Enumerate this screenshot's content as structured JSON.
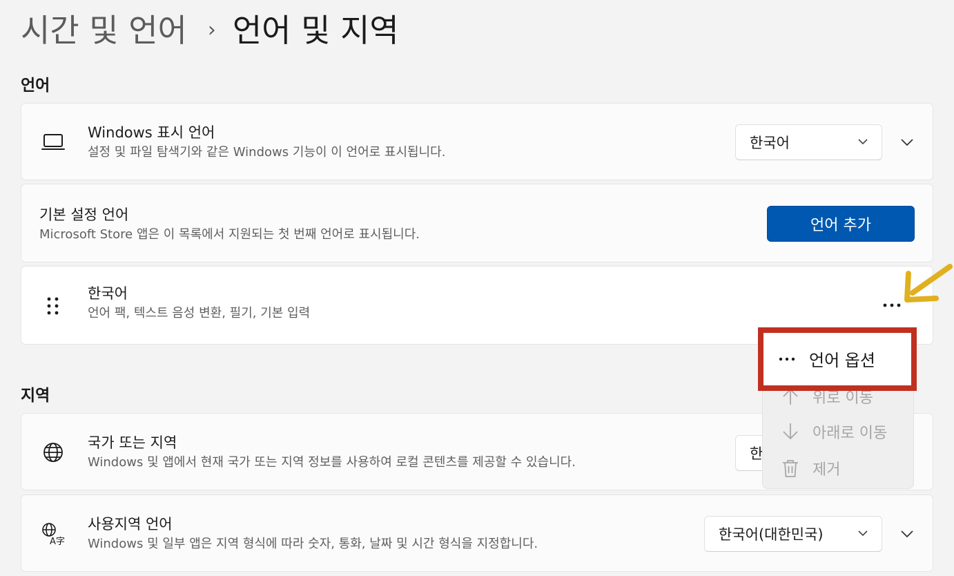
{
  "breadcrumb": {
    "parent": "시간 및 언어",
    "separator": "›",
    "current": "언어 및 지역"
  },
  "language_section": {
    "heading": "언어",
    "display_language": {
      "title": "Windows 표시 언어",
      "description": "설정 및 파일 탐색기와 같은 Windows 기능이 이 언어로 표시됩니다.",
      "selected": "한국어",
      "icon": "laptop-icon"
    },
    "preferred_languages": {
      "title": "기본 설정 언어",
      "description": "Microsoft Store 앱은 이 목록에서 지원되는 첫 번째 언어로 표시됩니다.",
      "add_button": "언어 추가"
    },
    "korean_entry": {
      "title": "한국어",
      "description": "언어 팩, 텍스트 음성 변환, 필기, 기본 입력",
      "icon": "drag-handle-icon"
    }
  },
  "context_menu": {
    "items": [
      {
        "label": "언어 옵션",
        "icon": "more-icon"
      },
      {
        "label": "위로 이동",
        "icon": "arrow-up-icon"
      },
      {
        "label": "아래로 이동",
        "icon": "arrow-down-icon"
      },
      {
        "label": "제거",
        "icon": "trash-icon"
      }
    ]
  },
  "region_section": {
    "heading": "지역",
    "country_region": {
      "title": "국가 또는 지역",
      "description": "Windows 및 앱에서 현재 국가 또는 지역 정보를 사용하여 로컬 콘텐츠를 제공할 수 있습니다.",
      "selected_partial": "한",
      "icon": "globe-icon"
    },
    "regional_format": {
      "title": "사용지역 언어",
      "description": "Windows 및 일부 앱은 지역 형식에 따라 숫자, 통화, 날짜 및 시간 형식을 지정합니다.",
      "selected": "한국어(대한민국)",
      "icon": "language-format-icon"
    }
  },
  "colors": {
    "accent": "#0058b0",
    "highlight": "#c0301f",
    "annotation_arrow": "#e0b020"
  }
}
